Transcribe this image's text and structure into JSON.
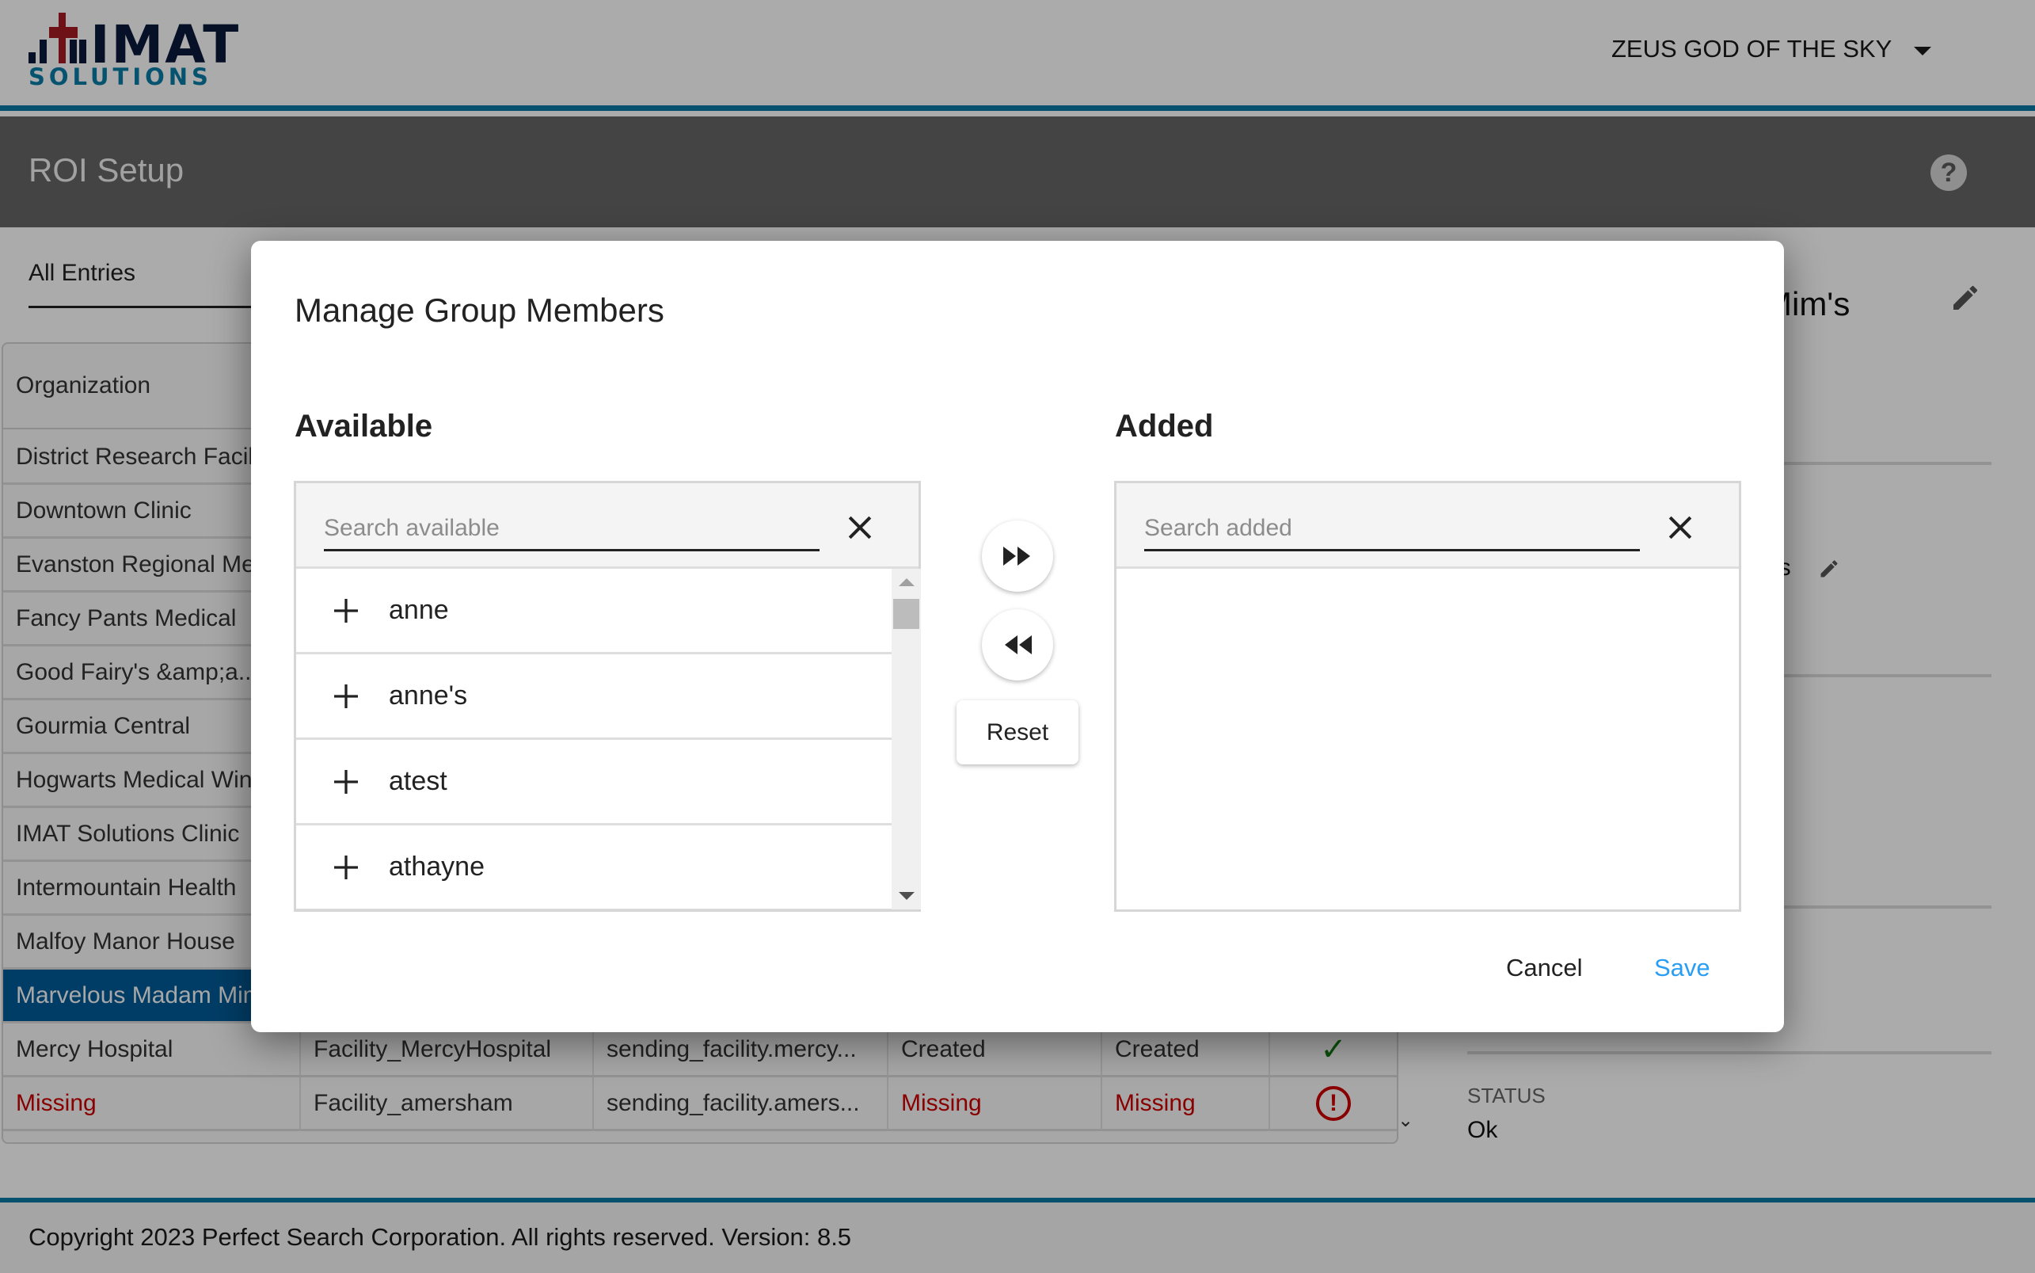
{
  "header": {
    "logo_main": "IMAT",
    "logo_sub": "SOLUTIONS",
    "user_name": "ZEUS GOD OF THE SKY",
    "page_title": "ROI Setup",
    "help_glyph": "?"
  },
  "tabs": {
    "all_entries": "All Entries"
  },
  "grid": {
    "column_header": "Organization",
    "rows": [
      {
        "org": "District Research Facility"
      },
      {
        "org": "Downtown Clinic"
      },
      {
        "org": "Evanston Regional Medical"
      },
      {
        "org": "Fancy Pants Medical"
      },
      {
        "org": "Good Fairy's &amp;a..."
      },
      {
        "org": "Gourmia Central"
      },
      {
        "org": "Hogwarts Medical Wing"
      },
      {
        "org": "IMAT Solutions Clinic"
      },
      {
        "org": "Intermountain Health"
      },
      {
        "org": "Malfoy Manor House"
      },
      {
        "org": "Marvelous Madam Mim's",
        "selected": true
      },
      {
        "org": "Mercy Hospital",
        "facility": "Facility_MercyHospital",
        "sending": "sending_facility.mercy...",
        "status1": "Created",
        "status2": "Created",
        "icon": "check-icon"
      },
      {
        "org": "Missing",
        "facility": "Facility_amersham",
        "sending": "sending_facility.amers...",
        "status1": "Missing",
        "status2": "Missing",
        "icon": "alert-circle-icon"
      }
    ]
  },
  "detail": {
    "name": "Mim's",
    "members_label": "ers",
    "status_label": "STATUS",
    "status_value": "Ok"
  },
  "footer": {
    "copyright": "Copyright 2023 Perfect Search Corporation. All rights reserved. Version: 8.5"
  },
  "modal": {
    "title": "Manage Group Members",
    "available": {
      "title": "Available",
      "search_placeholder": "Search available",
      "search_value": "",
      "items": [
        "anne",
        "anne's",
        "atest",
        "athayne"
      ]
    },
    "added": {
      "title": "Added",
      "search_placeholder": "Search added",
      "search_value": "",
      "items": []
    },
    "add_all_icon": "fast-forward-icon",
    "remove_all_icon": "rewind-icon",
    "reset_label": "Reset",
    "cancel_label": "Cancel",
    "save_label": "Save"
  },
  "colors": {
    "accent": "#0a79a4",
    "selected_row": "#005b99",
    "error": "#cc0000",
    "success": "#127a12",
    "save_link": "#2a9df4"
  }
}
